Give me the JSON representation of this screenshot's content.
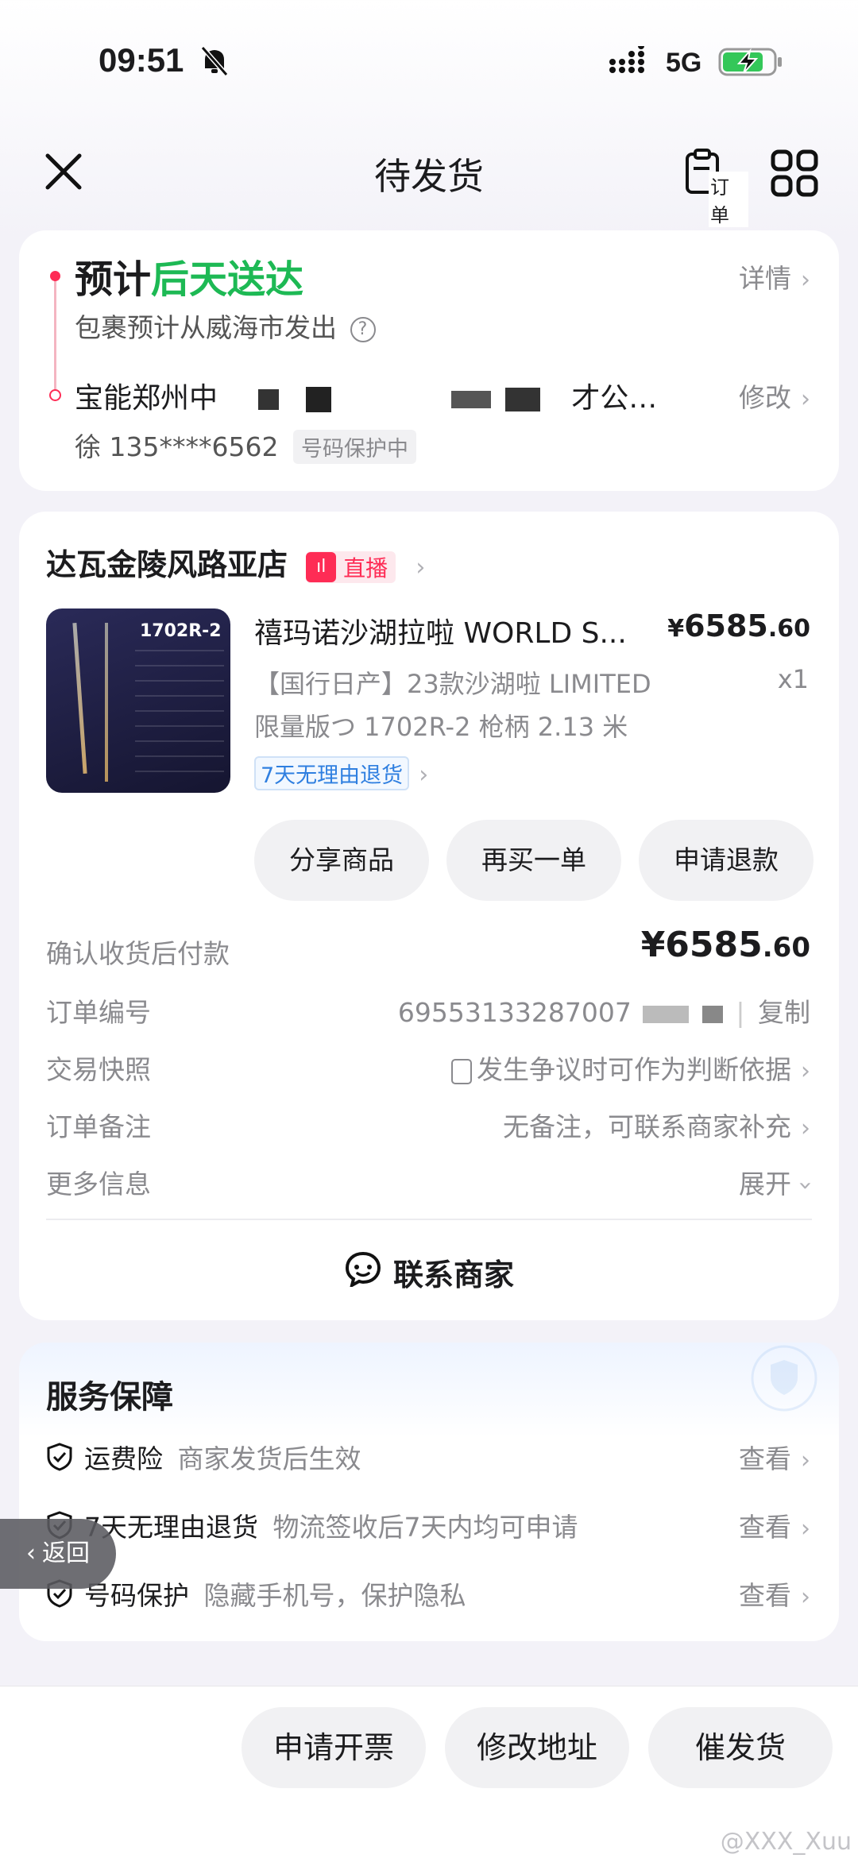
{
  "status_bar": {
    "time": "09:51",
    "network": "5G"
  },
  "header": {
    "title": "待发货",
    "orders_label": "订单"
  },
  "delivery": {
    "estimate_prefix": "预计",
    "estimate_highlight": "后天送达",
    "details_label": "详情",
    "origin_text": "包裹预计从威海市发出",
    "address_start": "宝能郑州中",
    "address_end": "才公…",
    "modify_label": "修改",
    "recipient": "徐 135****6562",
    "protect_badge": "号码保护中"
  },
  "store": {
    "name": "达瓦金陵风路亚店",
    "live_label": "直播",
    "product": {
      "title": "禧玛诺沙湖拉啦 WORLD S...",
      "desc_line1": "【国行日产】23款沙湖啦 LIMITED",
      "desc_line2": "限量版つ 1702R-2 枪柄 2.13 米",
      "price_symbol": "¥",
      "price_int": "6585",
      "price_dec": ".60",
      "qty": "x1",
      "return_badge": "7天无理由退货",
      "thumb_model": "1702R-2"
    },
    "buttons": {
      "share": "分享商品",
      "rebuy": "再买一单",
      "refund": "申请退款"
    },
    "pay_label": "确认收货后付款",
    "pay_amount_int": "¥6585",
    "pay_amount_dec": ".60",
    "rows": [
      {
        "label": "订单编号",
        "value": "69553133287007",
        "action": "复制"
      },
      {
        "label": "交易快照",
        "value": "发生争议时可作为判断依据"
      },
      {
        "label": "订单备注",
        "value": "无备注，可联系商家补充"
      },
      {
        "label": "更多信息",
        "value": "展开"
      }
    ],
    "contact": "联系商家"
  },
  "service": {
    "title": "服务保障",
    "items": [
      {
        "name": "运费险",
        "desc": "商家发货后生效",
        "action": "查看"
      },
      {
        "name": "7天无理由退货",
        "desc": "物流签收后7天内均可申请",
        "action": "查看"
      },
      {
        "name": "号码保护",
        "desc": "隐藏手机号，保护隐私",
        "action": "查看"
      }
    ]
  },
  "back_button": "返回",
  "bottom_bar": {
    "invoice": "申请开票",
    "modify_address": "修改地址",
    "urge": "催发货"
  },
  "watermark": "@XXX_Xuu",
  "colors": {
    "green": "#1db954",
    "red": "#fe2c55",
    "blue": "#2f7fe0"
  }
}
